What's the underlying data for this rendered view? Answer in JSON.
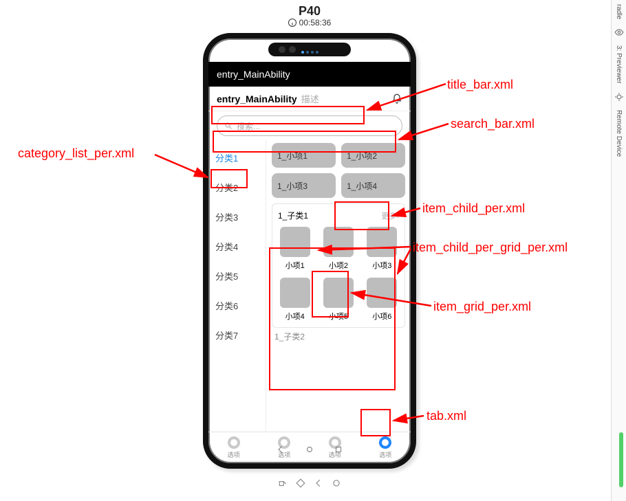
{
  "device": {
    "name": "P40",
    "elapsed": "00:58:36"
  },
  "app": {
    "window_title": "entry_MainAbility",
    "title_text": "entry_MainAbility",
    "title_desc": "描述",
    "search_placeholder": "搜索..."
  },
  "categories": [
    "分类1",
    "分类2",
    "分类3",
    "分类4",
    "分类5",
    "分类6",
    "分类7"
  ],
  "active_category_index": 0,
  "child_items": [
    "1_小项1",
    "1_小项2",
    "1_小项3",
    "1_小项4"
  ],
  "sub_section": {
    "title": "1_子类1",
    "more": "更多",
    "grid": [
      "小项1",
      "小项2",
      "小项3",
      "小项4",
      "小项5",
      "小项6"
    ]
  },
  "next_section_peek": "1_子类2",
  "tabs": {
    "label": "选项",
    "count": 4,
    "active_index": 3
  },
  "annotations": {
    "category_list": "category_list_per.xml",
    "title_bar": "title_bar.xml",
    "search_bar": "search_bar.xml",
    "item_child": "item_child_per.xml",
    "item_child_grid": "item_child_per_grid_per.xml",
    "item_grid": "item_grid_per.xml",
    "tab": "tab.xml"
  },
  "side_panels": {
    "top": "radle",
    "previewer": "3: Previewer",
    "remote": "Remote Device"
  },
  "icons": {
    "clock": "clock-icon",
    "bell": "bell-icon",
    "search": "search-icon",
    "back": "back-icon",
    "home": "home-icon",
    "recent": "recent-icon",
    "eye": "eye-icon",
    "target": "target-icon",
    "chevron": "chevron-right-icon"
  }
}
